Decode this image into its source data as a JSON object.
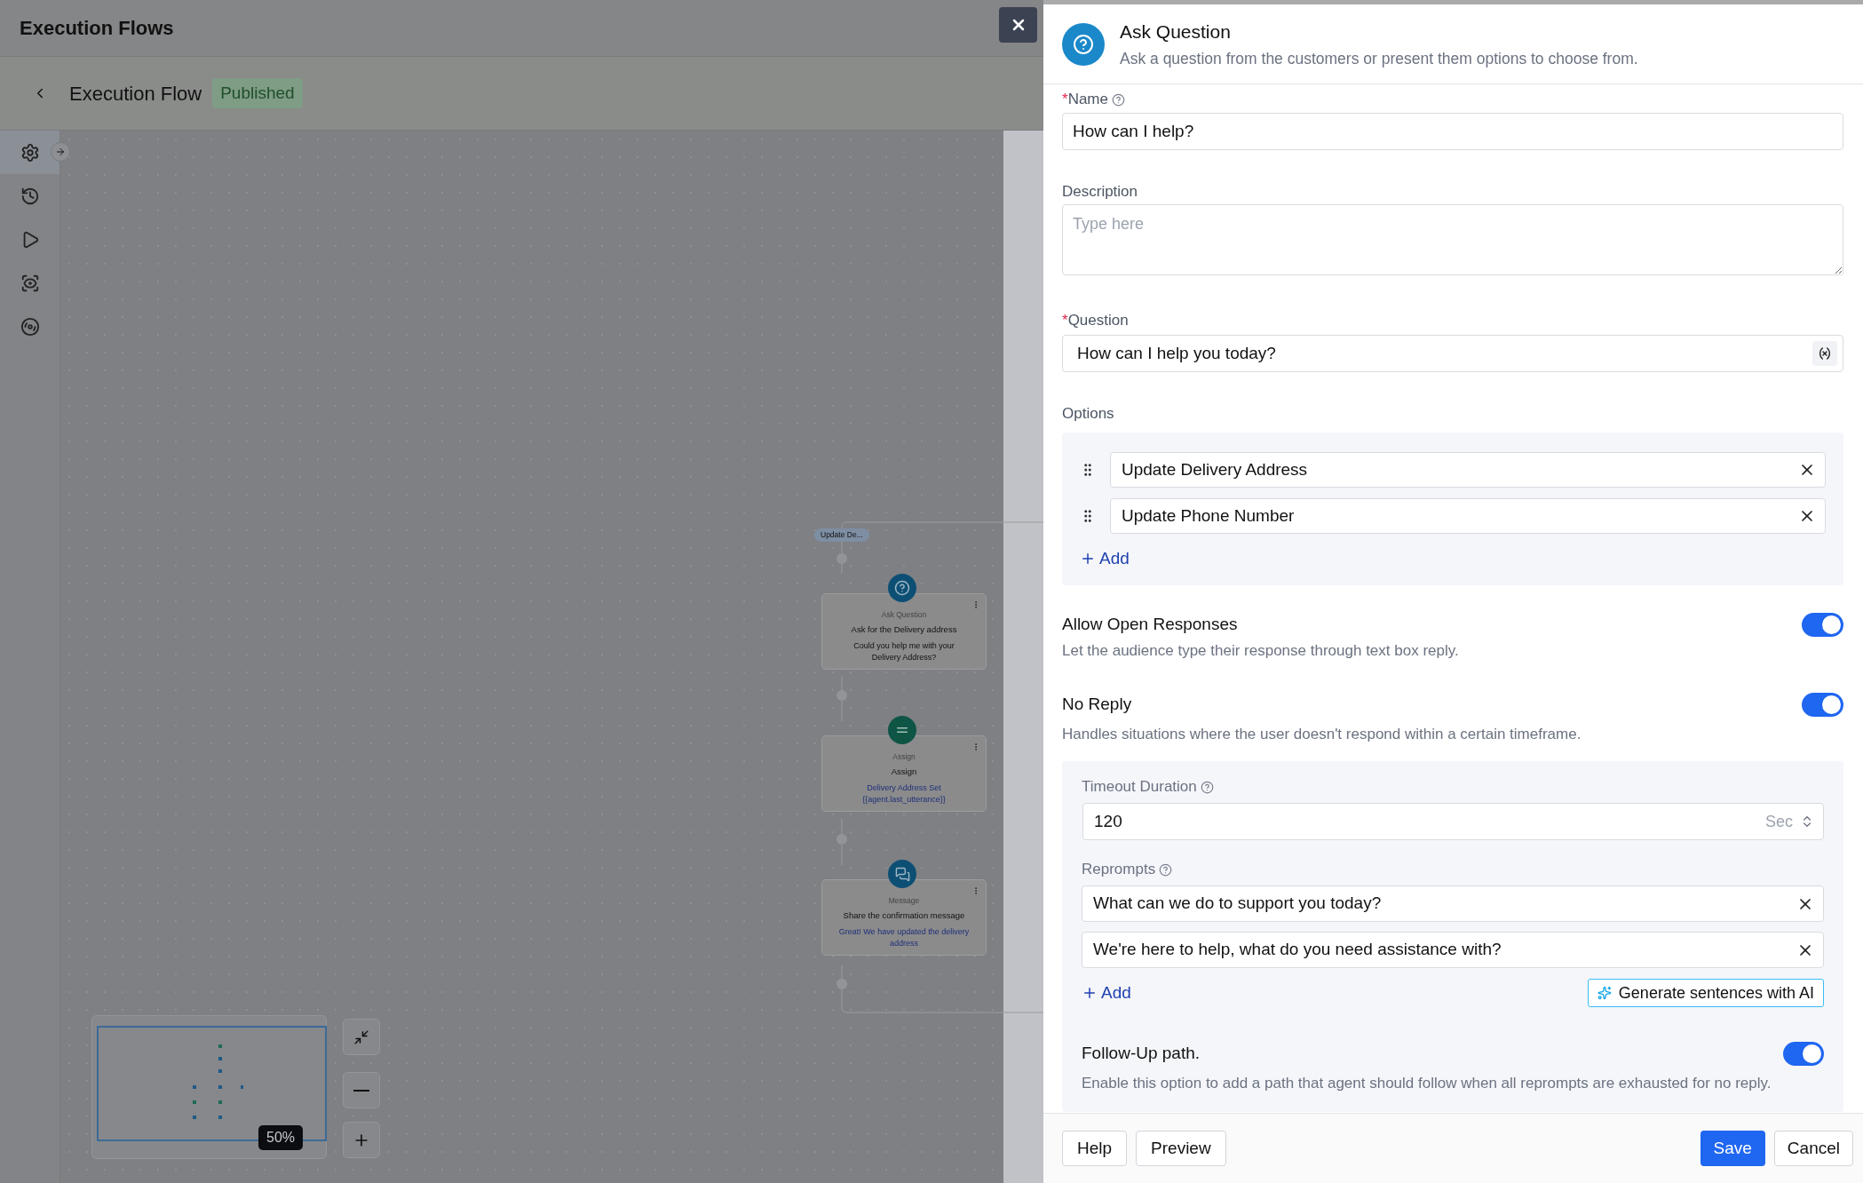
{
  "app": {
    "title": "Execution Flows"
  },
  "flow": {
    "title": "Execution Flow",
    "status": "Published"
  },
  "rail": [
    {
      "kind": "settings",
      "selected": true
    },
    {
      "kind": "history",
      "selected": false
    },
    {
      "kind": "run",
      "selected": false
    },
    {
      "kind": "preview",
      "selected": false
    },
    {
      "kind": "target",
      "selected": false
    }
  ],
  "canvas": {
    "branch_label": "Update De...",
    "nodes": [
      {
        "kind": "question",
        "type": "Ask Question",
        "title": "Ask for the Delivery address",
        "body": "Could you help me with your Delivery Address?"
      },
      {
        "kind": "assign",
        "type": "Assign",
        "title": "Assign",
        "body": "Delivery Address Set {{agent.last_utterance}}"
      },
      {
        "kind": "message",
        "type": "Message",
        "title": "Share the confirmation message",
        "body": "Great! We have updated the delivery address"
      }
    ],
    "zoom": "50%"
  },
  "panel": {
    "title": "Ask Question",
    "subtitle": "Ask a question from the customers or present them options to choose from.",
    "name": {
      "required_mark": "*",
      "label": "Name",
      "value": "How can I help?"
    },
    "description": {
      "label": "Description",
      "placeholder": "Type here"
    },
    "question": {
      "required_mark": "*",
      "label": "Question",
      "value": "How can I help you today?"
    },
    "options": {
      "label": "Options",
      "items": [
        "Update Delivery Address",
        "Update Phone Number"
      ],
      "add": "Add"
    },
    "allow_open": {
      "title": "Allow Open Responses",
      "description": "Let the audience type their response through text box reply.",
      "on": true
    },
    "no_reply": {
      "title": "No Reply",
      "description": "Handles situations where the user doesn't respond within a certain timeframe.",
      "on": true,
      "timeout": {
        "label": "Timeout Duration",
        "value": "120",
        "unit": "Sec"
      },
      "reprompts": {
        "label": "Reprompts",
        "items": [
          "What can we do to support you today?",
          "We're here to help, what do you need assistance with?"
        ],
        "add": "Add",
        "generate": "Generate sentences with AI"
      },
      "follow_up": {
        "title": "Follow-Up path.",
        "description": "Enable this option to add a path that agent should follow when all reprompts are exhausted for no reply.",
        "on": true
      }
    },
    "footer": {
      "left": [
        "Help",
        "Preview"
      ],
      "save": "Save",
      "cancel": "Cancel"
    }
  }
}
